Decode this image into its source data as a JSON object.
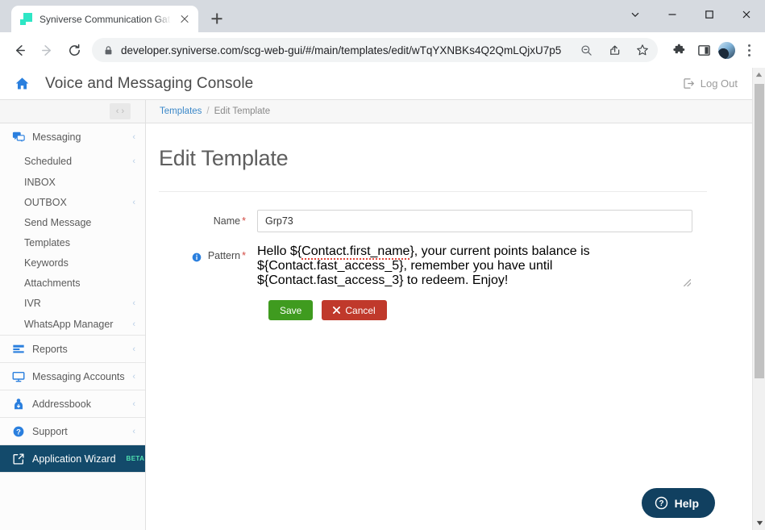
{
  "browser": {
    "tab": {
      "title": "Syniverse Communication Gatew…",
      "favicon": "syniverse-logo-icon"
    },
    "newtab_label": "+",
    "window_controls": [
      "chevron-down-icon",
      "minimize-icon",
      "maximize-icon",
      "close-icon"
    ],
    "nav": {
      "back": "back-arrow-icon",
      "forward": "forward-arrow-icon",
      "reload": "reload-icon"
    },
    "url": {
      "lock": "lock-icon",
      "domain": "developer.syniverse.com",
      "path": "/scg-web-gui/#/main/templates/edit/wTqYXNBKs4Q2QmLQjxU7p5",
      "full": "developer.syniverse.com/scg-web-gui/#/main/templates/edit/wTqYXNBKs4Q2QmLQjxU7p5"
    },
    "omnibox_icons": [
      "zoom-out-icon",
      "share-icon",
      "bookmark-star-icon"
    ],
    "toolbar_icons": [
      "extensions-puzzle-icon",
      "side-panel-icon",
      "profile-avatar",
      "kebab-menu-icon"
    ]
  },
  "app": {
    "home_icon": "home-icon",
    "title": "Voice and Messaging Console",
    "logout": {
      "icon": "logout-icon",
      "label": "Log Out"
    }
  },
  "sidebar": {
    "collapse_label": "‹ ›",
    "groups": [
      {
        "item": {
          "label": "Messaging",
          "icon": "messaging-icon",
          "chevron": "‹",
          "active": false
        },
        "children": [
          {
            "label": "Scheduled",
            "chevron": "‹"
          },
          {
            "label": "INBOX",
            "chevron": ""
          },
          {
            "label": "OUTBOX",
            "chevron": "‹"
          },
          {
            "label": "Send Message",
            "chevron": ""
          },
          {
            "label": "Templates",
            "chevron": ""
          },
          {
            "label": "Keywords",
            "chevron": ""
          },
          {
            "label": "Attachments",
            "chevron": ""
          },
          {
            "label": "IVR",
            "chevron": "‹"
          },
          {
            "label": "WhatsApp Manager",
            "chevron": "‹"
          }
        ]
      },
      {
        "item": {
          "label": "Reports",
          "icon": "reports-icon",
          "chevron": "‹",
          "active": false
        },
        "children": []
      },
      {
        "item": {
          "label": "Messaging Accounts",
          "icon": "monitor-icon",
          "chevron": "‹",
          "active": false
        },
        "children": []
      },
      {
        "item": {
          "label": "Addressbook",
          "icon": "addressbook-icon",
          "chevron": "‹",
          "active": false
        },
        "children": []
      },
      {
        "item": {
          "label": "Support",
          "icon": "support-question-icon",
          "chevron": "‹",
          "active": false
        },
        "children": []
      },
      {
        "item": {
          "label": "Application Wizard",
          "icon": "external-link-icon",
          "chevron": "",
          "active": true,
          "badge": "BETA"
        },
        "children": []
      }
    ]
  },
  "breadcrumb": {
    "parent": "Templates",
    "separator": "/",
    "current": "Edit Template"
  },
  "page": {
    "title": "Edit Template",
    "fields": {
      "name": {
        "label": "Name",
        "required": "*",
        "value": "Grp73",
        "placeholder": ""
      },
      "pattern": {
        "label": "Pattern",
        "required": "*",
        "info_icon": "info-circle-icon",
        "value": "Hello ${Contact.first_name}, your current points balance is ${Contact.fast_access_5}, remember you have until ${Contact.fast_access_3} to redeem. Enjoy!",
        "value_part1": "Hello ${",
        "value_misspelled": "Contact.first_name",
        "value_part2": "}, your current points balance is ${Contact.fast_access_5}, remember you have until ${Contact.fast_access_3} to redeem. Enjoy!",
        "placeholder": ""
      }
    },
    "buttons": {
      "save": {
        "label": "Save"
      },
      "cancel": {
        "label": "Cancel",
        "icon": "x-icon"
      }
    }
  },
  "help": {
    "label": "Help",
    "icon": "question-circle-icon"
  },
  "colors": {
    "accent_blue": "#2a7fde",
    "link_blue": "#3a87c8",
    "active_nav": "#134a6b",
    "save_green": "#3f9b1f",
    "cancel_red": "#c0392b",
    "help_navy": "#114060",
    "beta_green": "#4fe0b0",
    "favicon_teal": "#2ee6c5"
  }
}
